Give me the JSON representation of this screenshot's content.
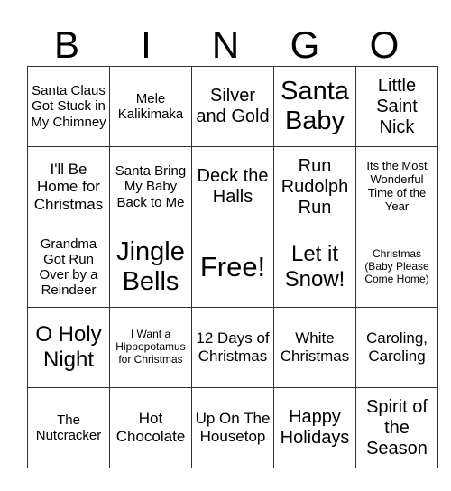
{
  "header": [
    "B",
    "I",
    "N",
    "G",
    "O"
  ],
  "rows": [
    [
      "Santa Claus Got Stuck in My Chimney",
      "Mele Kalikimaka",
      "Silver and Gold",
      "Santa Baby",
      "Little Saint Nick"
    ],
    [
      "I'll Be Home for Christmas",
      "Santa Bring My Baby Back to Me",
      "Deck the Halls",
      "Run Rudolph Run",
      "Its the Most Wonderful Time of the Year"
    ],
    [
      "Grandma Got Run Over by a Reindeer",
      "Jingle Bells",
      "Free!",
      "Let it Snow!",
      "Christmas (Baby Please Come Home)"
    ],
    [
      "O Holy Night",
      "I Want a Hippopotamus for Christmas",
      "12 Days of Christmas",
      "White Christmas",
      "Caroling, Caroling"
    ],
    [
      "The Nutcracker",
      "Hot Chocolate",
      "Up On The Housetop",
      "Happy Holidays",
      "Spirit of the Season"
    ]
  ]
}
